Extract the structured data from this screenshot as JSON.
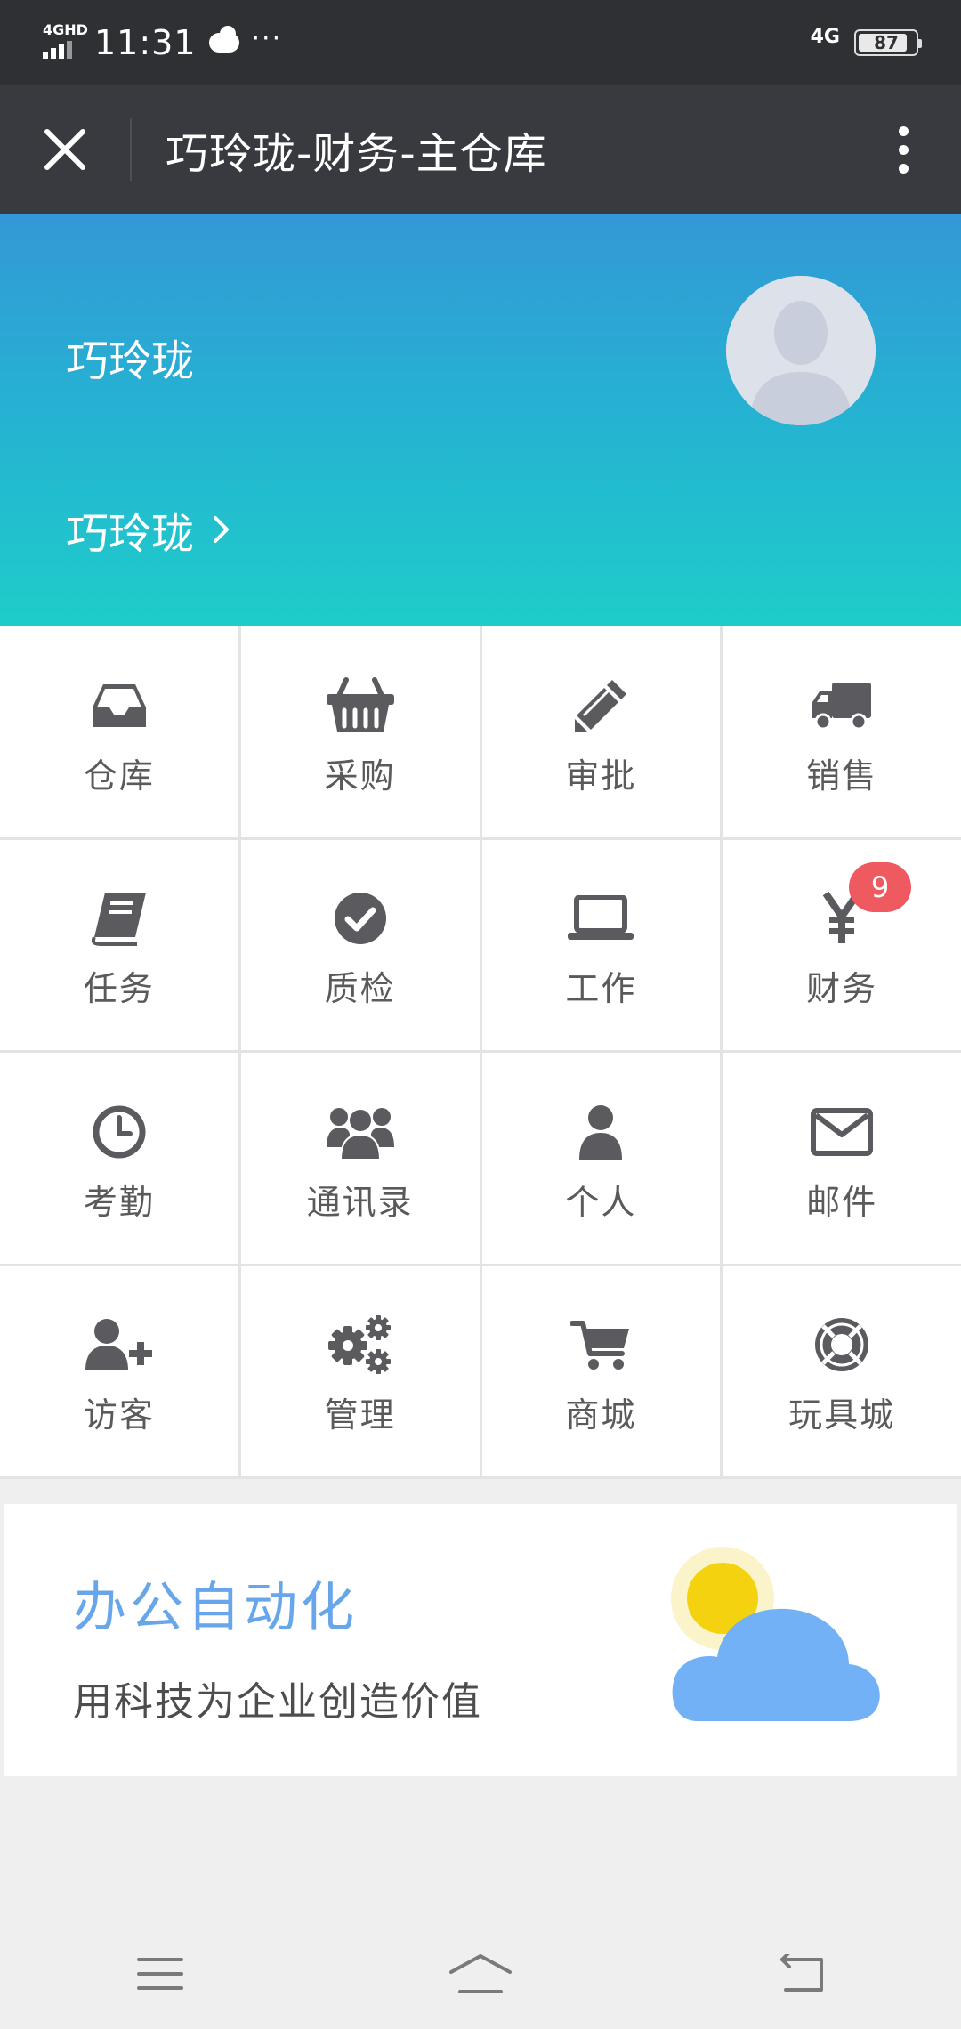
{
  "status_bar": {
    "network": "4GHD",
    "time": "11:31",
    "more": "···",
    "network_right": "4G",
    "battery": "87",
    "battery_level": 0.87
  },
  "title_bar": {
    "title": "巧玲珑-财务-主仓库",
    "close_icon": "close-icon",
    "more_icon": "more-vertical-icon"
  },
  "profile": {
    "name": "巧玲珑",
    "link_label": "巧玲珑",
    "link_icon": "chevron-right-icon",
    "avatar_icon": "default-avatar-icon"
  },
  "grid": [
    {
      "label": "仓库",
      "icon": "inbox-icon"
    },
    {
      "label": "采购",
      "icon": "basket-icon"
    },
    {
      "label": "审批",
      "icon": "pencil-icon"
    },
    {
      "label": "销售",
      "icon": "truck-icon"
    },
    {
      "label": "任务",
      "icon": "book-icon"
    },
    {
      "label": "质检",
      "icon": "check-circle-icon"
    },
    {
      "label": "工作",
      "icon": "laptop-icon"
    },
    {
      "label": "财务",
      "icon": "yen-icon",
      "badge": "9"
    },
    {
      "label": "考勤",
      "icon": "clock-icon"
    },
    {
      "label": "通讯录",
      "icon": "users-icon"
    },
    {
      "label": "个人",
      "icon": "user-icon"
    },
    {
      "label": "邮件",
      "icon": "envelope-icon"
    },
    {
      "label": "访客",
      "icon": "user-plus-icon"
    },
    {
      "label": "管理",
      "icon": "gears-icon"
    },
    {
      "label": "商城",
      "icon": "cart-icon"
    },
    {
      "label": "玩具城",
      "icon": "life-ring-icon"
    }
  ],
  "banner": {
    "title": "办公自动化",
    "subtitle": "用科技为企业创造价值",
    "art_icon": "sun-cloud-icon"
  },
  "nav_bar": {
    "menu_icon": "menu-icon",
    "home_icon": "home-icon",
    "back_icon": "back-icon"
  },
  "colors": {
    "status_bar": "#2f3034",
    "title_bar": "#393a3f",
    "header_top": "#3398d6",
    "header_bottom": "#1ecdc9",
    "icon": "#5b5b5f",
    "badge": "#ee5a5f",
    "banner_title": "#67a6ea"
  }
}
